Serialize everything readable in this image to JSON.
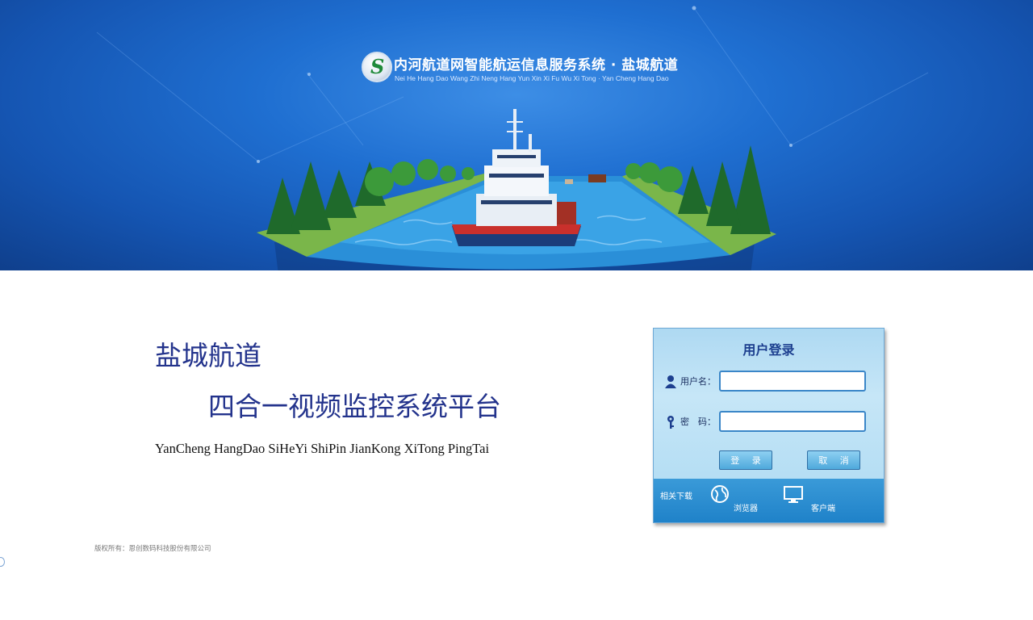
{
  "header": {
    "title": "内河航道网智能航运信息服务系统 · 盐城航道",
    "pinyin": "Nei He Hang Dao Wang Zhi Neng Hang Yun Xin Xi Fu Wu Xi Tong · Yan Cheng Hang Dao",
    "logo_text": "S"
  },
  "intro": {
    "line1": "盐城航道",
    "line2": "四合一视频监控系统平台",
    "pinyin": "YanCheng HangDao SiHeYi ShiPin JianKong XiTong PingTai"
  },
  "footer": {
    "copyright": "版权所有：恩创数码科技股份有限公司"
  },
  "login": {
    "title": "用户登录",
    "username_label": "用户名：",
    "username_value": "",
    "password_label": "密　码：",
    "password_value": "",
    "login_button": "登 录",
    "cancel_button": "取 消",
    "downloads_label": "相关下载",
    "download_browser": "浏览器",
    "download_client": "客户端"
  },
  "colors": {
    "hero_blue": "#1f6fd1",
    "heading_navy": "#23338c",
    "panel_light": "#c6e6f7",
    "panel_dark": "#1f82c9"
  },
  "icons": [
    "user-icon",
    "key-icon",
    "globe-icon",
    "monitor-icon"
  ]
}
